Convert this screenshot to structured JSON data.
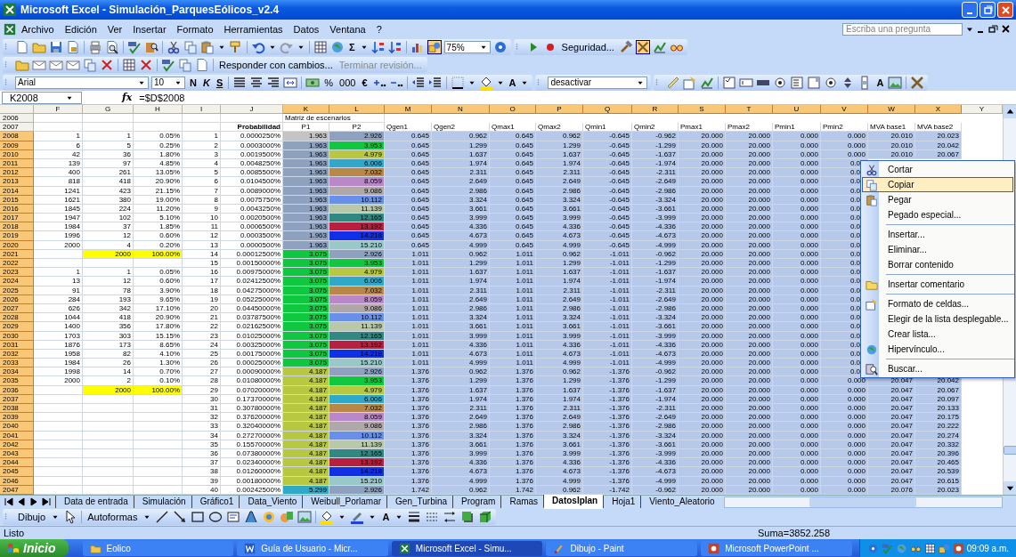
{
  "window": {
    "title": "Microsoft Excel - Simulación_ParquesEólicos_v2.4"
  },
  "menu_bar": {
    "items": [
      "Archivo",
      "Edición",
      "Ver",
      "Insertar",
      "Formato",
      "Herramientas",
      "Datos",
      "Ventana",
      "?"
    ],
    "help_search": {
      "placeholder": "Escriba una pregunta"
    }
  },
  "standard_toolbar": {
    "functions": "Σ",
    "zoom": "75%",
    "security": "Seguridad..."
  },
  "reviewing_toolbar": {
    "reply": "Responder con cambios...",
    "end_review": "Terminar revisión..."
  },
  "formatting_toolbar": {
    "font": "Arial",
    "size": "10",
    "bold": "N",
    "italic": "K",
    "underline": "S",
    "percent": "%",
    "thousands": "000",
    "currency": "€",
    "font_color": "A",
    "style": "desactivar",
    "label": "A"
  },
  "formula_bar": {
    "name_box": "K2008",
    "fx": "fx",
    "formula": "=$D$2008"
  },
  "columns": [
    {
      "label": "F",
      "selected": false
    },
    {
      "label": "G",
      "selected": false
    },
    {
      "label": "H",
      "selected": false
    },
    {
      "label": "I",
      "selected": false
    },
    {
      "label": "J",
      "selected": false
    },
    {
      "label": "K",
      "selected": true
    },
    {
      "label": "L",
      "selected": true
    },
    {
      "label": "M",
      "selected": true
    },
    {
      "label": "N",
      "selected": true
    },
    {
      "label": "O",
      "selected": true
    },
    {
      "label": "P",
      "selected": true
    },
    {
      "label": "Q",
      "selected": true
    },
    {
      "label": "R",
      "selected": true
    },
    {
      "label": "S",
      "selected": true
    },
    {
      "label": "T",
      "selected": true
    },
    {
      "label": "U",
      "selected": true
    },
    {
      "label": "V",
      "selected": true
    },
    {
      "label": "W",
      "selected": true
    },
    {
      "label": "X",
      "selected": true
    },
    {
      "label": "Y",
      "selected": false
    }
  ],
  "rows": [
    {
      "header": "2006",
      "kind": "title",
      "selected": false,
      "cells": [
        null,
        null,
        null,
        null,
        null,
        "Matriz de escenarios"
      ]
    },
    {
      "header": "2007",
      "kind": "header",
      "selected": false,
      "cells": [
        null,
        null,
        null,
        null,
        "Probabilidad",
        "P1",
        "P2",
        "Qgen1",
        "Qgen2",
        "Qmax1",
        "Qmax2",
        "Qmin1",
        "Qmin2",
        "Pmax1",
        "Pmax2",
        "Pmin1",
        "Pmin2",
        "MVA base1",
        "MVA base2"
      ]
    },
    {
      "header": "2008",
      "kind": "data",
      "selected": true,
      "cells": [
        "1",
        "1",
        "0.05%",
        "1",
        "0.0000250%",
        {
          "text": "1.963",
          "color": "#c4c4c4"
        },
        {
          "text": "2.926",
          "color": "#8ea2c0"
        },
        "0.645",
        "0.962",
        "0.645",
        "0.962",
        "-0.645",
        "-0.962",
        "20.000",
        "20.000",
        "0.000",
        "0.000",
        "20.010",
        "20.023"
      ]
    },
    {
      "header": "2009",
      "kind": "data",
      "selected": true,
      "cells": [
        "6",
        "5",
        "0.25%",
        "2",
        "0.0003000%",
        {
          "text": "1.963",
          "color": "#8ea2c0"
        },
        {
          "text": "3.953",
          "color": "#10c840"
        },
        "0.645",
        "1.299",
        "0.645",
        "1.299",
        "-0.645",
        "-1.299",
        "20.000",
        "20.000",
        "0.000",
        "0.000",
        "20.010",
        "20.042"
      ]
    },
    {
      "header": "2010",
      "kind": "data",
      "selected": true,
      "cells": [
        "42",
        "36",
        "1.80%",
        "3",
        "0.0019500%",
        {
          "text": "1.963",
          "color": "#8ea2c0"
        },
        {
          "text": "4.979",
          "color": "#b8c840"
        },
        "0.645",
        "1.637",
        "0.645",
        "1.637",
        "-0.645",
        "-1.637",
        "20.000",
        "20.000",
        "0.000",
        "0.000",
        "20.010",
        "20.067"
      ]
    },
    {
      "header": "2011",
      "kind": "data",
      "selected": true,
      "cells": [
        "139",
        "97",
        "4.85%",
        "4",
        "0.0048250%",
        {
          "text": "1.963",
          "color": "#8ea2c0"
        },
        {
          "text": "6.006",
          "color": "#30a8c8"
        },
        "0.645",
        "1.974",
        "0.645",
        "1.974",
        "-0.645",
        "-1.974",
        "20.000",
        "20.000",
        "0.000",
        "0.0"
      ]
    },
    {
      "header": "2012",
      "kind": "data",
      "selected": true,
      "cells": [
        "400",
        "261",
        "13.05%",
        "5",
        "0.0085500%",
        {
          "text": "1.963",
          "color": "#8ea2c0"
        },
        {
          "text": "7.032",
          "color": "#b88848"
        },
        "0.645",
        "2.311",
        "0.645",
        "2.311",
        "-0.645",
        "-2.311",
        "20.000",
        "20.000",
        "0.000",
        "0.0"
      ]
    },
    {
      "header": "2013",
      "kind": "data",
      "selected": true,
      "cells": [
        "818",
        "418",
        "20.90%",
        "6",
        "0.0104500%",
        {
          "text": "1.963",
          "color": "#8ea2c0"
        },
        {
          "text": "8.059",
          "color": "#b888c8"
        },
        "0.645",
        "2.649",
        "0.645",
        "2.649",
        "-0.645",
        "-2.649",
        "20.000",
        "20.000",
        "0.000",
        "0.0"
      ]
    },
    {
      "header": "2014",
      "kind": "data",
      "selected": true,
      "cells": [
        "1241",
        "423",
        "21.15%",
        "7",
        "0.0089000%",
        {
          "text": "1.963",
          "color": "#8ea2c0"
        },
        {
          "text": "9.086",
          "color": "#b0a8a8"
        },
        "0.645",
        "2.986",
        "0.645",
        "2.986",
        "-0.645",
        "-2.986",
        "20.000",
        "20.000",
        "0.000",
        "0.0"
      ]
    },
    {
      "header": "2015",
      "kind": "data",
      "selected": true,
      "cells": [
        "1621",
        "380",
        "19.00%",
        "8",
        "0.0075750%",
        {
          "text": "1.963",
          "color": "#8ea2c0"
        },
        {
          "text": "10.112",
          "color": "#6890e8"
        },
        "0.645",
        "3.324",
        "0.645",
        "3.324",
        "-0.645",
        "-3.324",
        "20.000",
        "20.000",
        "0.000",
        "0.0"
      ]
    },
    {
      "header": "2016",
      "kind": "data",
      "selected": true,
      "cells": [
        "1845",
        "224",
        "11.20%",
        "9",
        "0.0043250%",
        {
          "text": "1.963",
          "color": "#8ea2c0"
        },
        {
          "text": "11.139",
          "color": "#b8c8a8"
        },
        "0.645",
        "3.661",
        "0.645",
        "3.661",
        "-0.645",
        "-3.661",
        "20.000",
        "20.000",
        "0.000",
        "0.0"
      ]
    },
    {
      "header": "2017",
      "kind": "data",
      "selected": true,
      "cells": [
        "1947",
        "102",
        "5.10%",
        "10",
        "0.0020500%",
        {
          "text": "1.963",
          "color": "#8ea2c0"
        },
        {
          "text": "12.165",
          "color": "#308880"
        },
        "0.645",
        "3.999",
        "0.645",
        "3.999",
        "-0.645",
        "-3.999",
        "20.000",
        "20.000",
        "0.000",
        "0.0"
      ]
    },
    {
      "header": "2018",
      "kind": "data",
      "selected": true,
      "cells": [
        "1984",
        "37",
        "1.85%",
        "11",
        "0.0006500%",
        {
          "text": "1.963",
          "color": "#8ea2c0"
        },
        {
          "text": "13.192",
          "color": "#b82040"
        },
        "0.645",
        "4.336",
        "0.645",
        "4.336",
        "-0.645",
        "-4.336",
        "20.000",
        "20.000",
        "0.000",
        "0.0"
      ]
    },
    {
      "header": "2019",
      "kind": "data",
      "selected": true,
      "cells": [
        "1996",
        "12",
        "0.60%",
        "12",
        "0.0003500%",
        {
          "text": "1.963",
          "color": "#8ea2c0"
        },
        {
          "text": "14.218",
          "color": "#1030e8"
        },
        "0.645",
        "4.673",
        "0.645",
        "4.673",
        "-0.645",
        "-4.673",
        "20.000",
        "20.000",
        "0.000",
        "0.0"
      ]
    },
    {
      "header": "2020",
      "kind": "data",
      "selected": true,
      "cells": [
        "2000",
        "4",
        "0.20%",
        "13",
        "0.0000500%",
        {
          "text": "1.963",
          "color": "#8ea2c0"
        },
        {
          "text": "15.210",
          "color": "#98c8c8"
        },
        "0.645",
        "4.999",
        "0.645",
        "4.999",
        "-0.645",
        "-4.999",
        "20.000",
        "20.000",
        "0.000",
        "0.0"
      ]
    },
    {
      "header": "2021",
      "kind": "data",
      "selected": true,
      "cells": [
        null,
        {
          "text": "2000",
          "color": "#ffff00"
        },
        {
          "text": "100.00%",
          "color": "#ffff00"
        },
        "14",
        "0.00012500%",
        {
          "text": "3.075",
          "color": "#10c840"
        },
        {
          "text": "2.926",
          "color": "#8ea2c0"
        },
        "1.011",
        "0.962",
        "1.011",
        "0.962",
        "-1.011",
        "-0.962",
        "20.000",
        "20.000",
        "0.000",
        "0.0"
      ]
    },
    {
      "header": "2022",
      "kind": "data",
      "selected": true,
      "cells": [
        null,
        null,
        null,
        "15",
        "0.00150000%",
        {
          "text": "3.075",
          "color": "#10c840"
        },
        {
          "text": "3.953",
          "color": "#10c840"
        },
        "1.011",
        "1.299",
        "1.011",
        "1.299",
        "-1.011",
        "-1.299",
        "20.000",
        "20.000",
        "0.000",
        "0.0"
      ]
    },
    {
      "header": "2023",
      "kind": "data",
      "selected": true,
      "cells": [
        "1",
        "1",
        "0.05%",
        "16",
        "0.00975000%",
        {
          "text": "3.075",
          "color": "#10c840"
        },
        {
          "text": "4.979",
          "color": "#b8c840"
        },
        "1.011",
        "1.637",
        "1.011",
        "1.637",
        "-1.011",
        "-1.637",
        "20.000",
        "20.000",
        "0.000",
        "0.0"
      ]
    },
    {
      "header": "2024",
      "kind": "data",
      "selected": true,
      "cells": [
        "13",
        "12",
        "0.60%",
        "17",
        "0.02412500%",
        {
          "text": "3.075",
          "color": "#10c840"
        },
        {
          "text": "6.006",
          "color": "#30a8c8"
        },
        "1.011",
        "1.974",
        "1.011",
        "1.974",
        "-1.011",
        "-1.974",
        "20.000",
        "20.000",
        "0.000",
        "0.0"
      ]
    },
    {
      "header": "2025",
      "kind": "data",
      "selected": true,
      "cells": [
        "91",
        "78",
        "3.90%",
        "18",
        "0.04275000%",
        {
          "text": "3.075",
          "color": "#10c840"
        },
        {
          "text": "7.032",
          "color": "#b88848"
        },
        "1.011",
        "2.311",
        "1.011",
        "2.311",
        "-1.011",
        "-2.311",
        "20.000",
        "20.000",
        "0.000",
        "0.0"
      ]
    },
    {
      "header": "2026",
      "kind": "data",
      "selected": true,
      "cells": [
        "284",
        "193",
        "9.65%",
        "19",
        "0.05225000%",
        {
          "text": "3.075",
          "color": "#10c840"
        },
        {
          "text": "8.059",
          "color": "#b888c8"
        },
        "1.011",
        "2.649",
        "1.011",
        "2.649",
        "-1.011",
        "-2.649",
        "20.000",
        "20.000",
        "0.000",
        "0.0"
      ]
    },
    {
      "header": "2027",
      "kind": "data",
      "selected": true,
      "cells": [
        "626",
        "342",
        "17.10%",
        "20",
        "0.04450000%",
        {
          "text": "3.075",
          "color": "#10c840"
        },
        {
          "text": "9.086",
          "color": "#b0a8a8"
        },
        "1.011",
        "2.986",
        "1.011",
        "2.986",
        "-1.011",
        "-2.986",
        "20.000",
        "20.000",
        "0.000",
        "0.0"
      ]
    },
    {
      "header": "2028",
      "kind": "data",
      "selected": true,
      "cells": [
        "1044",
        "418",
        "20.90%",
        "21",
        "0.03787500%",
        {
          "text": "3.075",
          "color": "#10c840"
        },
        {
          "text": "10.112",
          "color": "#6890e8"
        },
        "1.011",
        "3.324",
        "1.011",
        "3.324",
        "-1.011",
        "-3.324",
        "20.000",
        "20.000",
        "0.000",
        "0.0"
      ]
    },
    {
      "header": "2029",
      "kind": "data",
      "selected": true,
      "cells": [
        "1400",
        "356",
        "17.80%",
        "22",
        "0.02162500%",
        {
          "text": "3.075",
          "color": "#10c840"
        },
        {
          "text": "11.139",
          "color": "#b8c8a8"
        },
        "1.011",
        "3.661",
        "1.011",
        "3.661",
        "-1.011",
        "-3.661",
        "20.000",
        "20.000",
        "0.000",
        "0.0"
      ]
    },
    {
      "header": "2030",
      "kind": "data",
      "selected": true,
      "cells": [
        "1703",
        "303",
        "15.15%",
        "23",
        "0.01025000%",
        {
          "text": "3.075",
          "color": "#10c840"
        },
        {
          "text": "12.165",
          "color": "#308880"
        },
        "1.011",
        "3.999",
        "1.011",
        "3.999",
        "-1.011",
        "-3.999",
        "20.000",
        "20.000",
        "0.000",
        "0.0"
      ]
    },
    {
      "header": "2031",
      "kind": "data",
      "selected": true,
      "cells": [
        "1876",
        "173",
        "8.65%",
        "24",
        "0.00325000%",
        {
          "text": "3.075",
          "color": "#10c840"
        },
        {
          "text": "13.192",
          "color": "#b82040"
        },
        "1.011",
        "4.336",
        "1.011",
        "4.336",
        "-1.011",
        "-4.336",
        "20.000",
        "20.000",
        "0.000",
        "0.0"
      ]
    },
    {
      "header": "2032",
      "kind": "data",
      "selected": true,
      "cells": [
        "1958",
        "82",
        "4.10%",
        "25",
        "0.00175000%",
        {
          "text": "3.075",
          "color": "#10c840"
        },
        {
          "text": "14.218",
          "color": "#1030e8"
        },
        "1.011",
        "4.673",
        "1.011",
        "4.673",
        "-1.011",
        "-4.673",
        "20.000",
        "20.000",
        "0.000",
        "0.0"
      ]
    },
    {
      "header": "2033",
      "kind": "data",
      "selected": true,
      "cells": [
        "1984",
        "26",
        "1.30%",
        "26",
        "0.00025000%",
        {
          "text": "3.075",
          "color": "#10c840"
        },
        {
          "text": "15.210",
          "color": "#98c8c8"
        },
        "1.011",
        "4.999",
        "1.011",
        "4.999",
        "-1.011",
        "-4.999",
        "20.000",
        "20.000",
        "0.000",
        "0.0"
      ]
    },
    {
      "header": "2034",
      "kind": "data",
      "selected": true,
      "cells": [
        "1998",
        "14",
        "0.70%",
        "27",
        "0.00090000%",
        {
          "text": "4.187",
          "color": "#b8c840"
        },
        {
          "text": "2.926",
          "color": "#8ea2c0"
        },
        "1.376",
        "0.962",
        "1.376",
        "0.962",
        "-1.376",
        "-0.962",
        "20.000",
        "20.000",
        "0.000",
        "0.0"
      ]
    },
    {
      "header": "2035",
      "kind": "data",
      "selected": true,
      "cells": [
        "2000",
        "2",
        "0.10%",
        "28",
        "0.01080000%",
        {
          "text": "4.187",
          "color": "#b8c840"
        },
        {
          "text": "3.953",
          "color": "#10c840"
        },
        "1.376",
        "1.299",
        "1.376",
        "1.299",
        "-1.376",
        "-1.299",
        "20.000",
        "20.000",
        "0.000",
        "0.000",
        "20.047",
        "20.042"
      ]
    },
    {
      "header": "2036",
      "kind": "data",
      "selected": true,
      "cells": [
        null,
        {
          "text": "2000",
          "color": "#ffff00"
        },
        {
          "text": "100.00%",
          "color": "#ffff00"
        },
        "29",
        "0.07020000%",
        {
          "text": "4.187",
          "color": "#b8c840"
        },
        {
          "text": "4.979",
          "color": "#b8c840"
        },
        "1.376",
        "1.637",
        "1.376",
        "1.637",
        "-1.376",
        "-1.637",
        "20.000",
        "20.000",
        "0.000",
        "0.000",
        "20.047",
        "20.067"
      ]
    },
    {
      "header": "2037",
      "kind": "data",
      "selected": true,
      "cells": [
        null,
        null,
        null,
        "30",
        "0.17370000%",
        {
          "text": "4.187",
          "color": "#b8c840"
        },
        {
          "text": "6.006",
          "color": "#30a8c8"
        },
        "1.376",
        "1.974",
        "1.376",
        "1.974",
        "-1.376",
        "-1.974",
        "20.000",
        "20.000",
        "0.000",
        "0.000",
        "20.047",
        "20.097"
      ]
    },
    {
      "header": "2038",
      "kind": "data",
      "selected": true,
      "cells": [
        null,
        null,
        null,
        "31",
        "0.30780000%",
        {
          "text": "4.187",
          "color": "#b8c840"
        },
        {
          "text": "7.032",
          "color": "#b88848"
        },
        "1.376",
        "2.311",
        "1.376",
        "2.311",
        "-1.376",
        "-2.311",
        "20.000",
        "20.000",
        "0.000",
        "0.000",
        "20.047",
        "20.133"
      ]
    },
    {
      "header": "2039",
      "kind": "data",
      "selected": true,
      "cells": [
        null,
        null,
        null,
        "32",
        "0.37620000%",
        {
          "text": "4.187",
          "color": "#b8c840"
        },
        {
          "text": "8.059",
          "color": "#b888c8"
        },
        "1.376",
        "2.649",
        "1.376",
        "2.649",
        "-1.376",
        "-2.649",
        "20.000",
        "20.000",
        "0.000",
        "0.000",
        "20.047",
        "20.175"
      ]
    },
    {
      "header": "2040",
      "kind": "data",
      "selected": true,
      "cells": [
        null,
        null,
        null,
        "33",
        "0.32040000%",
        {
          "text": "4.187",
          "color": "#b8c840"
        },
        {
          "text": "9.086",
          "color": "#b0a8a8"
        },
        "1.376",
        "2.986",
        "1.376",
        "2.986",
        "-1.376",
        "-2.986",
        "20.000",
        "20.000",
        "0.000",
        "0.000",
        "20.047",
        "20.222"
      ]
    },
    {
      "header": "2041",
      "kind": "data",
      "selected": true,
      "cells": [
        null,
        null,
        null,
        "34",
        "0.27270000%",
        {
          "text": "4.187",
          "color": "#b8c840"
        },
        {
          "text": "10.112",
          "color": "#6890e8"
        },
        "1.376",
        "3.324",
        "1.376",
        "3.324",
        "-1.376",
        "-3.324",
        "20.000",
        "20.000",
        "0.000",
        "0.000",
        "20.047",
        "20.274"
      ]
    },
    {
      "header": "2042",
      "kind": "data",
      "selected": true,
      "cells": [
        null,
        null,
        null,
        "35",
        "0.15570000%",
        {
          "text": "4.187",
          "color": "#b8c840"
        },
        {
          "text": "11.139",
          "color": "#b8c8a8"
        },
        "1.376",
        "3.661",
        "1.376",
        "3.661",
        "-1.376",
        "-3.661",
        "20.000",
        "20.000",
        "0.000",
        "0.000",
        "20.047",
        "20.332"
      ]
    },
    {
      "header": "2043",
      "kind": "data",
      "selected": true,
      "cells": [
        null,
        null,
        null,
        "36",
        "0.07380000%",
        {
          "text": "4.187",
          "color": "#b8c840"
        },
        {
          "text": "12.165",
          "color": "#308880"
        },
        "1.376",
        "3.999",
        "1.376",
        "3.999",
        "-1.376",
        "-3.999",
        "20.000",
        "20.000",
        "0.000",
        "0.000",
        "20.047",
        "20.396"
      ]
    },
    {
      "header": "2044",
      "kind": "data",
      "selected": true,
      "cells": [
        null,
        null,
        null,
        "37",
        "0.02340000%",
        {
          "text": "4.187",
          "color": "#b8c840"
        },
        {
          "text": "13.192",
          "color": "#b82040"
        },
        "1.376",
        "4.336",
        "1.376",
        "4.336",
        "-1.376",
        "-4.336",
        "20.000",
        "20.000",
        "0.000",
        "0.000",
        "20.047",
        "20.465"
      ]
    },
    {
      "header": "2045",
      "kind": "data",
      "selected": true,
      "cells": [
        null,
        null,
        null,
        "38",
        "0.01260000%",
        {
          "text": "4.187",
          "color": "#b8c840"
        },
        {
          "text": "14.218",
          "color": "#1030e8"
        },
        "1.376",
        "4.673",
        "1.376",
        "4.673",
        "-1.376",
        "-4.673",
        "20.000",
        "20.000",
        "0.000",
        "0.000",
        "20.047",
        "20.539"
      ]
    },
    {
      "header": "2046",
      "kind": "data",
      "selected": true,
      "cells": [
        null,
        null,
        null,
        "39",
        "0.00180000%",
        {
          "text": "4.187",
          "color": "#b8c840"
        },
        {
          "text": "15.210",
          "color": "#98c8c8"
        },
        "1.376",
        "4.999",
        "1.376",
        "4.999",
        "-1.376",
        "-4.999",
        "20.000",
        "20.000",
        "0.000",
        "0.000",
        "20.047",
        "20.615"
      ]
    },
    {
      "header": "2047",
      "kind": "data",
      "selected": true,
      "cells": [
        null,
        null,
        null,
        "40",
        "0.00242500%",
        {
          "text": "5.299",
          "color": "#30a8c8"
        },
        {
          "text": "2.926",
          "color": "#8ea2c0"
        },
        "1.742",
        "0.962",
        "1.742",
        "0.962",
        "-1.742",
        "-0.962",
        "20.000",
        "20.000",
        "0.000",
        "0.000",
        "20.076",
        "20.023"
      ]
    }
  ],
  "context_menu": {
    "items": [
      {
        "label": "Cortar",
        "kind": "cut",
        "selected": false,
        "divider_above": false
      },
      {
        "label": "Copiar",
        "kind": "copy",
        "selected": true,
        "divider_above": false
      },
      {
        "label": "Pegar",
        "kind": "paste",
        "selected": false,
        "divider_above": false
      },
      {
        "label": "Pegado especial...",
        "kind": "plain",
        "selected": false,
        "divider_above": false
      },
      {
        "label": "Insertar...",
        "kind": "plain",
        "selected": false,
        "divider_above": true
      },
      {
        "label": "Eliminar...",
        "kind": "plain",
        "selected": false,
        "divider_above": false
      },
      {
        "label": "Borrar contenido",
        "kind": "plain",
        "selected": false,
        "divider_above": false
      },
      {
        "label": "Insertar comentario",
        "kind": "comment",
        "selected": false,
        "divider_above": true
      },
      {
        "label": "Formato de celdas...",
        "kind": "format",
        "selected": false,
        "divider_above": true
      },
      {
        "label": "Elegir de la lista desplegable...",
        "kind": "plain",
        "selected": false,
        "divider_above": false
      },
      {
        "label": "Crear lista...",
        "kind": "plain",
        "selected": false,
        "divider_above": false
      },
      {
        "label": "Hipervínculo...",
        "kind": "link",
        "selected": false,
        "divider_above": false
      },
      {
        "label": "Buscar...",
        "kind": "find",
        "selected": false,
        "divider_above": true
      }
    ]
  },
  "sheet_tabs": [
    {
      "label": "Data de entrada",
      "selected": false
    },
    {
      "label": "Simulación",
      "selected": false
    },
    {
      "label": "Gráfico1",
      "selected": false
    },
    {
      "label": "Data_Viento",
      "selected": false
    },
    {
      "label": "Weibull_Porlamar",
      "selected": false
    },
    {
      "label": "Gen_Turbina",
      "selected": false
    },
    {
      "label": "Program",
      "selected": false
    },
    {
      "label": "Ramas",
      "selected": false
    },
    {
      "label": "DatosIplan",
      "selected": true
    },
    {
      "label": "Hoja1",
      "selected": false
    },
    {
      "label": "Viento_Aleatorio",
      "selected": false
    }
  ],
  "drawing_toolbar": {
    "draw": "Dibujo",
    "autoshapes": "Autoformas",
    "font_color": "A"
  },
  "status_bar": {
    "state": "Listo",
    "sum": "Suma=3852.258"
  },
  "taskbar": {
    "start": "Inicio",
    "tasks": [
      {
        "label": "Eolico",
        "kind": "folder",
        "selected": false
      },
      {
        "label": "Guía de Usuario - Micr...",
        "kind": "word",
        "selected": false
      },
      {
        "label": "Microsoft Excel - Simu...",
        "kind": "excel",
        "selected": true
      },
      {
        "label": "Dibujo - Paint",
        "kind": "paint",
        "selected": false
      },
      {
        "label": "Microsoft PowerPoint ...",
        "kind": "powerpoint",
        "selected": false
      }
    ],
    "clock": "09:09 a.m."
  }
}
